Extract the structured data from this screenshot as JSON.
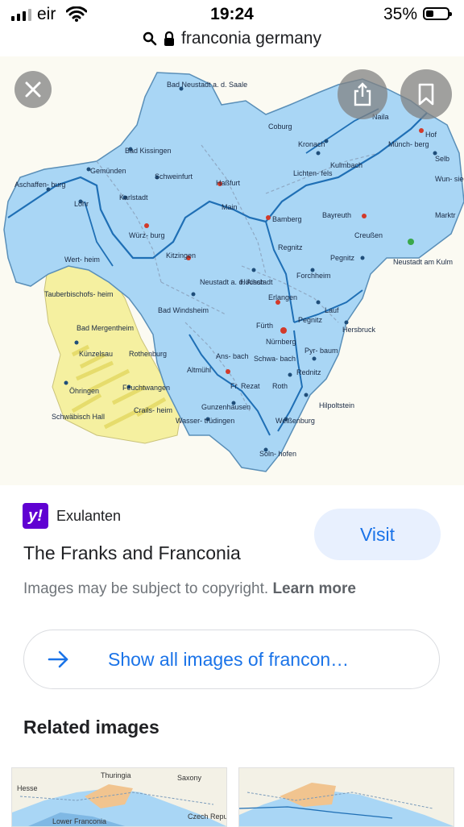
{
  "status_bar": {
    "carrier": "eir",
    "time": "19:24",
    "battery": "35%"
  },
  "url_bar": {
    "query": "franconia germany"
  },
  "image": {
    "map_labels": {
      "bad_neustadt": "Bad Neustadt a. d. Saale",
      "coburg": "Coburg",
      "naila": "Naila",
      "hof": "Hof",
      "kronach": "Kronach",
      "muenchberg": "Münch- berg",
      "selb": "Selb",
      "bad_kissingen": "Bad Kissingen",
      "kulmbach": "Kulmbach",
      "wunsiedel": "Wun- siedel",
      "aschaffenburg": "Aschaffen- burg",
      "gemuenden": "Gemünden",
      "schweinfurt": "Schweinfurt",
      "hassfurt": "Haßfurt",
      "lichtenfels": "Lichten- fels",
      "marktredwitz": "Marktr",
      "lohr": "Lohr",
      "karlstadt": "Karlstadt",
      "main": "Main",
      "bamberg": "Bamberg",
      "bayreuth": "Bayreuth",
      "creussen": "Creußen",
      "wuerzburg": "Würz- burg",
      "kitzingen": "Kitzingen",
      "regnitz": "Regnitz",
      "neustadt_kulm": "Neustadt am Kulm",
      "pegnitz": "Pegnitz",
      "wertheim": "Wert- heim",
      "forchheim": "Forchheim",
      "tauberbischofsheim": "Tauberbischofs- heim",
      "neustadt_aisch": "Neustadt a. d. Aisch",
      "hoechstadt": "Höchstadt",
      "erlangen": "Erlangen",
      "bad_windsheim": "Bad Windsheim",
      "lauf": "Lauf",
      "pegnitz_river": "Pegnitz",
      "bad_mergentheim": "Bad Mergentheim",
      "fuerth": "Fürth",
      "nuernberg": "Nürnberg",
      "hersbruck": "Hersbruck",
      "kuenzelsau": "Künzelsau",
      "rothenburg": "Rothenburg",
      "ansbach": "Ans- bach",
      "schwabach": "Schwa- bach",
      "pyrbaum": "Pyr- baum",
      "altmuehl": "Altmühl",
      "fr_rezat": "Fr. Rezat",
      "rednitz": "Rednitz",
      "oehringen": "Öhringen",
      "feuchtwangen": "Feuchtwangen",
      "roth": "Roth",
      "hilpoltstein": "Hilpoltstein",
      "schwaebisch_hall": "Schwäbisch Hall",
      "crailsheim": "Crails- heim",
      "gunzenhausen": "Gunzenhausen",
      "wassertruedingen": "Wasser- trüdingen",
      "weissenburg": "Weißenburg",
      "solnhofen": "Soln- hofen"
    }
  },
  "actions": {
    "close_icon": "close-icon",
    "share_icon": "share-icon",
    "save_icon": "bookmark-icon"
  },
  "result": {
    "source_logo_text": "y!",
    "source_name": "Exulanten",
    "title": "The Franks and Franconia",
    "visit_label": "Visit",
    "copyright_text": "Images may be subject to copyright.",
    "learn_more": "Learn more",
    "show_all_label": "Show all images of francon…"
  },
  "related": {
    "heading": "Related images",
    "thumb1": {
      "labels": [
        "Hesse",
        "Thuringia",
        "Saxony",
        "Czech Republik",
        "Lower Franconia"
      ]
    },
    "thumb2": {
      "labels": []
    }
  },
  "colors": {
    "accent": "#1a73e8",
    "map_blue": "#a9d6f5",
    "map_yellow": "#f5f0a0",
    "yahoo": "#6001d2"
  }
}
